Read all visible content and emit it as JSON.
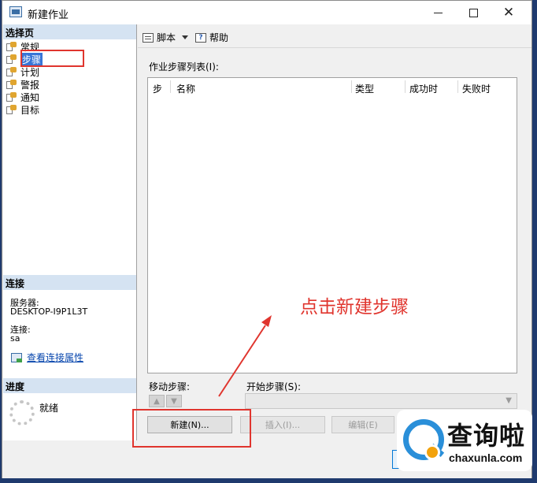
{
  "window": {
    "title": "新建作业"
  },
  "left_panel": {
    "select_page_header": "选择页",
    "pages": [
      {
        "label": "常规",
        "icon": "page-wrench-icon",
        "selected": false
      },
      {
        "label": "步骤",
        "icon": "page-wrench-icon",
        "selected": true
      },
      {
        "label": "计划",
        "icon": "page-wrench-icon",
        "selected": false
      },
      {
        "label": "警报",
        "icon": "page-wrench-icon",
        "selected": false
      },
      {
        "label": "通知",
        "icon": "page-wrench-icon",
        "selected": false
      },
      {
        "label": "目标",
        "icon": "page-wrench-icon",
        "selected": false
      }
    ],
    "connection_header": "连接",
    "server_label": "服务器:",
    "server_value": "DESKTOP-I9P1L3T",
    "connection_label": "连接:",
    "connection_value": "sa",
    "view_connection_link": "查看连接属性",
    "progress_header": "进度",
    "progress_status": "就绪"
  },
  "toolbar": {
    "script_label": "脚本",
    "help_label": "帮助"
  },
  "steps": {
    "list_label": "作业步骤列表(I):",
    "columns": [
      "步",
      "名称",
      "类型",
      "成功时",
      "失败时"
    ],
    "move_label": "移动步骤:",
    "start_label": "开始步骤(S):",
    "new_button": "新建(N)...",
    "insert_button": "插入(I)...",
    "edit_button": "编辑(E)"
  },
  "annotation": {
    "text": "点击新建步骤",
    "color": "#e0352e"
  },
  "watermark": {
    "name": "查询啦",
    "domain": "chaxunla.com"
  }
}
